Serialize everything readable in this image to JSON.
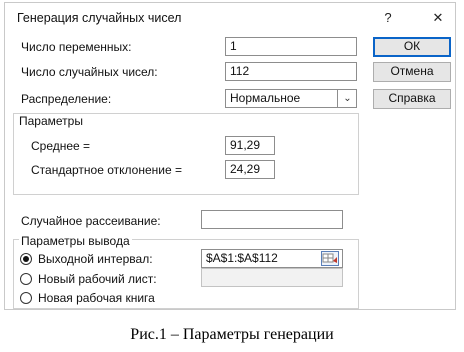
{
  "dialog": {
    "title": "Генерация случайных чисел",
    "help": "?",
    "close": "✕"
  },
  "fields": {
    "num_vars_label": "Число переменных:",
    "num_vars_value": "1",
    "num_random_label": "Число случайных чисел:",
    "num_random_value": "112",
    "distribution_label": "Распределение:",
    "distribution_value": "Нормальное",
    "seed_label": "Случайное рассеивание:",
    "seed_value": ""
  },
  "params": {
    "header": "Параметры",
    "mean_label": "Среднее =",
    "mean_value": "91,29",
    "std_label": "Стандартное отклонение =",
    "std_value": "24,29"
  },
  "output": {
    "header": "Параметры вывода",
    "option_range": "Выходной интервал:",
    "range_value": "$A$1:$A$112",
    "option_new_sheet": "Новый рабочий лист:",
    "new_sheet_value": "",
    "option_new_book": "Новая рабочая книга",
    "selected": "range"
  },
  "buttons": {
    "ok": "ОК",
    "cancel": "Отмена",
    "help": "Справка"
  },
  "caption": "Рис.1 – Параметры генерации"
}
